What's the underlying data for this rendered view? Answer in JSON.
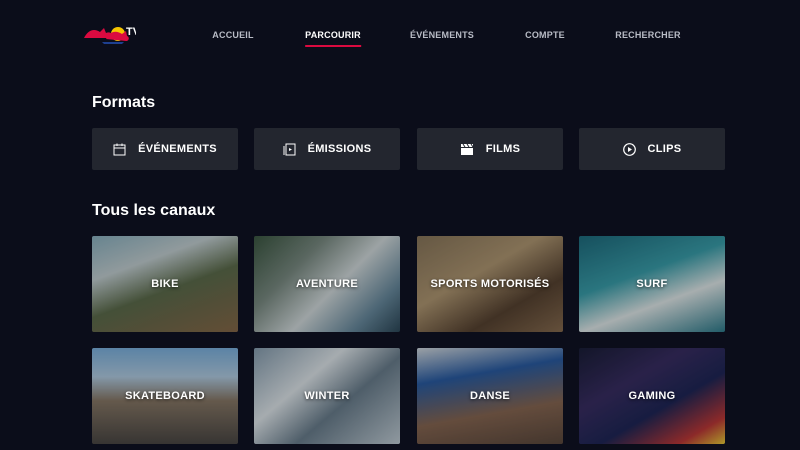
{
  "brand": {
    "logo_name": "Red Bull TV",
    "tv_text": "TV"
  },
  "nav": {
    "items": [
      {
        "label": "ACCUEIL"
      },
      {
        "label": "PARCOURIR",
        "active": true
      },
      {
        "label": "ÉVÉNEMENTS"
      },
      {
        "label": "COMPTE"
      },
      {
        "label": "RECHERCHER"
      }
    ],
    "accent_color": "#db0a40"
  },
  "formats": {
    "title": "Formats",
    "buttons": [
      {
        "label": "ÉVÉNEMENTS",
        "icon": "calendar-icon"
      },
      {
        "label": "ÉMISSIONS",
        "icon": "episodes-icon"
      },
      {
        "label": "FILMS",
        "icon": "clapperboard-icon"
      },
      {
        "label": "CLIPS",
        "icon": "play-circle-icon"
      }
    ]
  },
  "channels": {
    "title": "Tous les canaux",
    "tiles": [
      {
        "label": "BIKE"
      },
      {
        "label": "AVENTURE"
      },
      {
        "label": "SPORTS MOTORISÉS"
      },
      {
        "label": "SURF"
      },
      {
        "label": "SKATEBOARD"
      },
      {
        "label": "WINTER"
      },
      {
        "label": "DANSE"
      },
      {
        "label": "GAMING"
      }
    ]
  }
}
